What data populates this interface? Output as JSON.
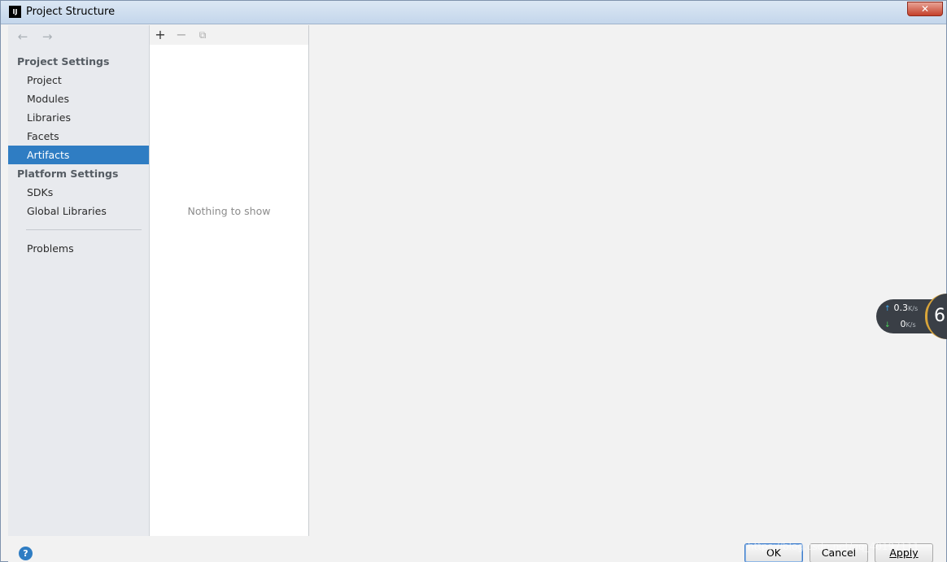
{
  "window": {
    "title": "Project Structure",
    "app_icon_text": "IJ",
    "close_label": "✕"
  },
  "nav": {
    "back_icon": "←",
    "forward_icon": "→"
  },
  "sidebar": {
    "project_settings_header": "Project Settings",
    "platform_settings_header": "Platform Settings",
    "items": [
      {
        "label": "Project"
      },
      {
        "label": "Modules"
      },
      {
        "label": "Libraries"
      },
      {
        "label": "Facets"
      },
      {
        "label": "Artifacts"
      },
      {
        "label": "SDKs"
      },
      {
        "label": "Global Libraries"
      },
      {
        "label": "Problems"
      }
    ],
    "selected_item": "Artifacts"
  },
  "toolbar": {
    "add_icon": "+",
    "remove_icon": "−",
    "copy_icon": "⧉"
  },
  "middle": {
    "empty_text": "Nothing to show"
  },
  "buttons": {
    "help": "?",
    "ok": "OK",
    "cancel": "Cancel",
    "apply": "Apply"
  },
  "net_monitor": {
    "upload": "0.3",
    "download": "0",
    "unit": "K/s",
    "gauge_value": "6",
    "up_arrow": "↑",
    "down_arrow": "↓"
  },
  "watermark": "https://blog.csdn.net/qq_40197111"
}
